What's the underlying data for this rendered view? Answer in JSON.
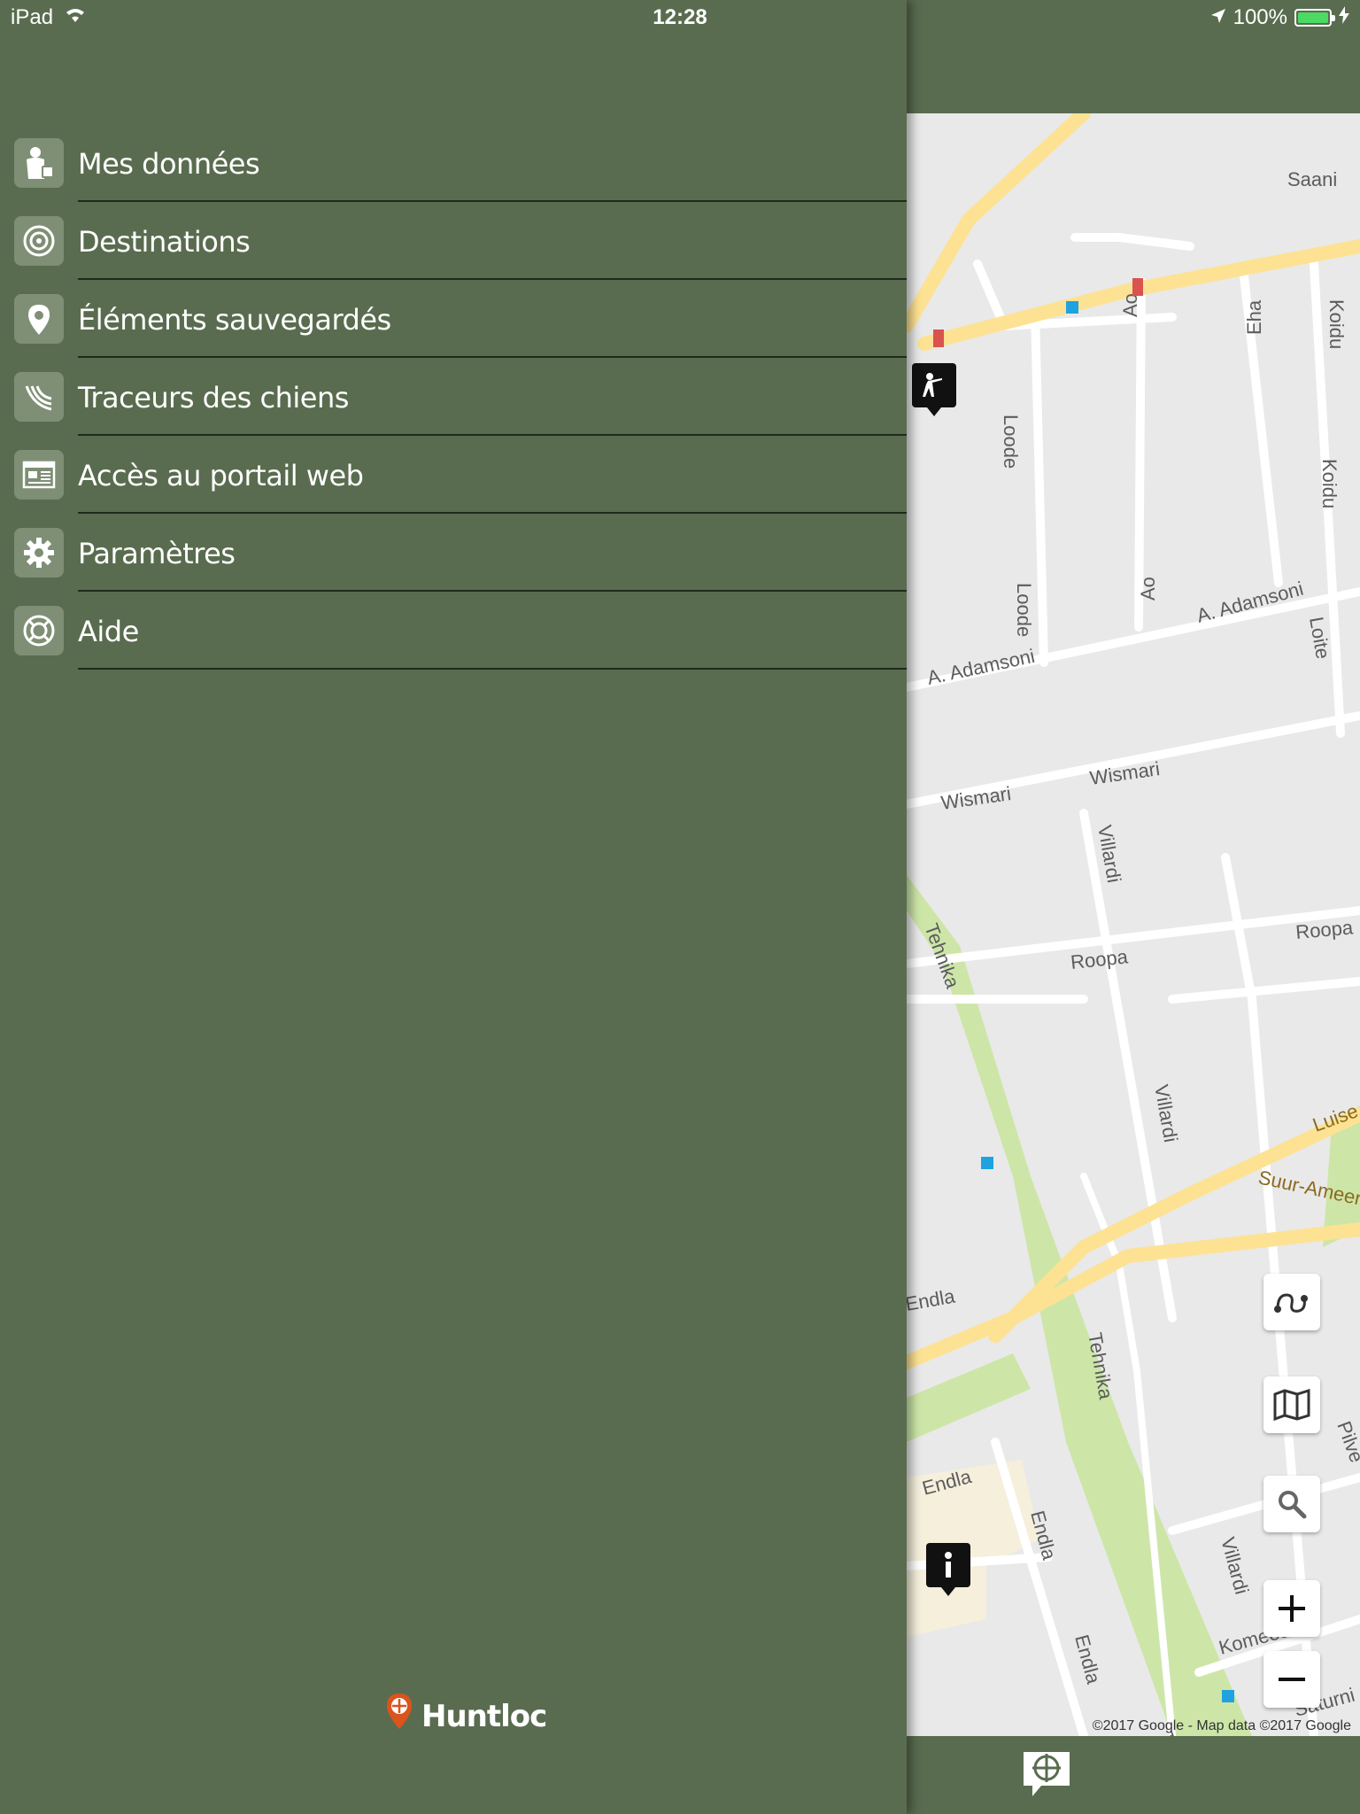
{
  "status_bar": {
    "device": "iPad",
    "time": "12:28",
    "battery": "100%"
  },
  "menu": {
    "items": [
      {
        "label": "Mes données",
        "icon": "user-data-icon"
      },
      {
        "label": "Destinations",
        "icon": "target-icon"
      },
      {
        "label": "Éléments sauvegardés",
        "icon": "location-pin-icon"
      },
      {
        "label": "Traceurs des chiens",
        "icon": "signal-waves-icon"
      },
      {
        "label": "Accès au portail web",
        "icon": "web-portal-icon"
      },
      {
        "label": "Paramètres",
        "icon": "gear-icon"
      },
      {
        "label": "Aide",
        "icon": "lifebuoy-icon"
      }
    ]
  },
  "brand": {
    "name": "Huntloc"
  },
  "map": {
    "copyright": "©2017 Google - Map data ©2017 Google",
    "street_labels": [
      "Saani",
      "Loode",
      "Ao",
      "Eha",
      "Koidu",
      "A. Adamsoni",
      "Loite",
      "Wismari",
      "Villardi",
      "Roopa",
      "Tehnika",
      "Luise",
      "Suur-Ameerika",
      "Endla",
      "Komeedi",
      "Pilve",
      "Saturni"
    ]
  },
  "colors": {
    "drawer_bg": "#5a6c4f",
    "icon_box": "#7f8f75",
    "divider": "#1f2a1c",
    "road_major": "#fde293",
    "park": "#cde6a8"
  }
}
